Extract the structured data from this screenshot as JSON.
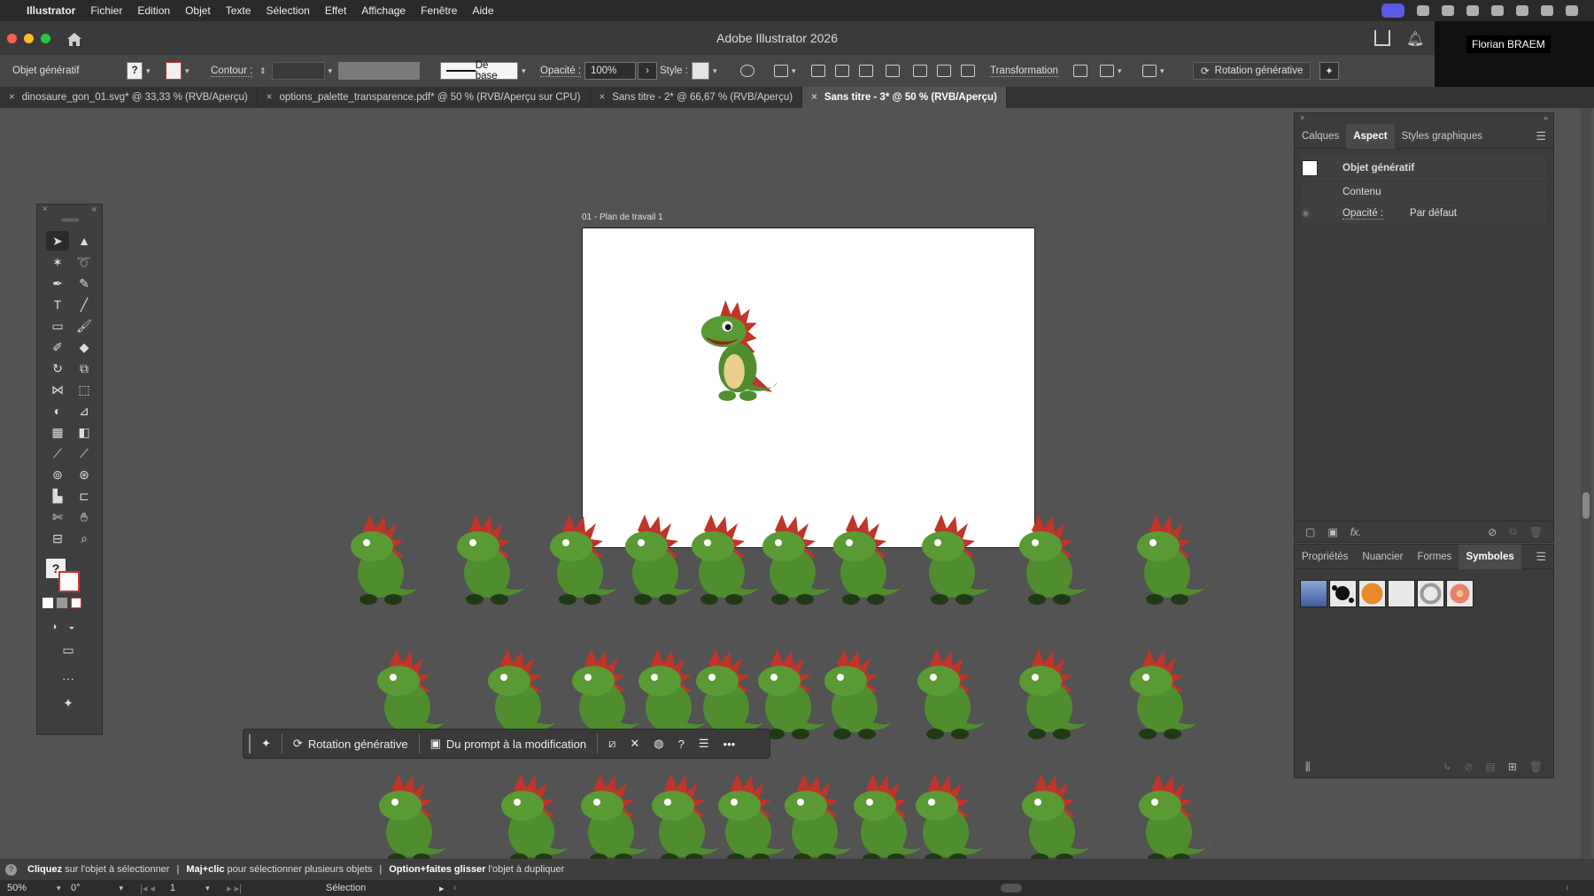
{
  "menubar": {
    "app": "Illustrator",
    "items": [
      "Fichier",
      "Edition",
      "Objet",
      "Texte",
      "Sélection",
      "Effet",
      "Affichage",
      "Fenêtre",
      "Aide"
    ]
  },
  "window": {
    "title": "Adobe Illustrator 2026",
    "user": "Florian BRAEM"
  },
  "control": {
    "object_type": "Objet génératif",
    "contour_label": "Contour :",
    "stroke_profile": "De base",
    "opacity_label": "Opacité :",
    "opacity_value": "100%",
    "style_label": "Style :",
    "transformation": "Transformation",
    "gen_rotation": "Rotation générative"
  },
  "tabs": [
    {
      "label": "dinosaure_gon_01.svg* @ 33,33 % (RVB/Aperçu)"
    },
    {
      "label": "options_palette_transparence.pdf* @ 50 % (RVB/Aperçu sur CPU)"
    },
    {
      "label": "Sans titre - 2* @ 66,67 % (RVB/Aperçu)"
    },
    {
      "label": "Sans titre - 3* @ 50 % (RVB/Aperçu)"
    }
  ],
  "artboard": {
    "label": "01 - Plan de travail 1"
  },
  "taskbar": {
    "rotation": "Rotation générative",
    "prompt": "Du prompt à la modification"
  },
  "panel_aspect": {
    "tabs": [
      "Calques",
      "Aspect",
      "Styles graphiques"
    ],
    "active_tab": "Aspect",
    "object_label": "Objet génératif",
    "content_label": "Contenu",
    "opacity_label": "Opacité :",
    "opacity_value": "Par défaut"
  },
  "panel_symbols": {
    "tabs": [
      "Propriétés",
      "Nuancier",
      "Formes",
      "Symboles"
    ],
    "active_tab": "Symboles"
  },
  "status": {
    "tip1_strong": "Cliquez",
    "tip1": "sur l'objet à sélectionner",
    "tip2_strong": "Maj+clic",
    "tip2": "pour sélectionner plusieurs objets",
    "tip3_strong": "Option+faites glisser",
    "tip3": "l'objet à dupliquer"
  },
  "bottombar": {
    "zoom": "50%",
    "rotation": "0°",
    "artboard_num": "1",
    "mode": "Sélection"
  },
  "colors": {
    "accent_blue": "#5a5ae0",
    "dino_green": "#4f8d2e",
    "dino_spike": "#c0342a"
  },
  "icons": [
    "apple-icon",
    "home-icon",
    "share-icon",
    "bell-icon",
    "selection-tool-icon",
    "direct-selection-tool-icon",
    "pen-tool-icon",
    "type-tool-icon",
    "rectangle-tool-icon",
    "brush-tool-icon",
    "zoom-tool-icon",
    "hand-tool-icon"
  ]
}
